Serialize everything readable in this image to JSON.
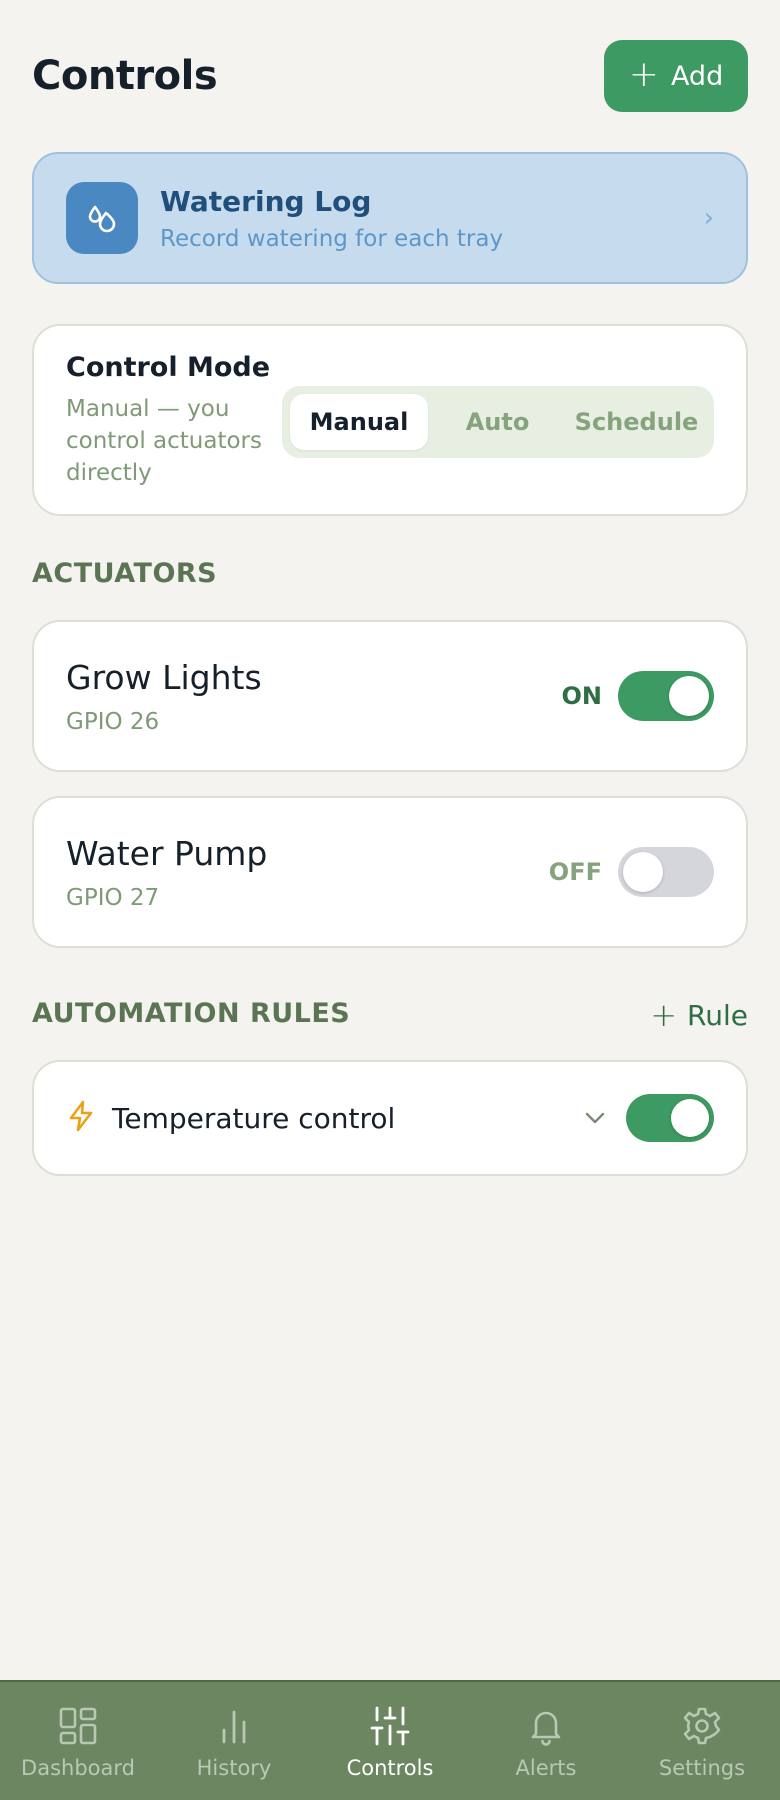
{
  "header": {
    "title": "Controls",
    "add_label": "Add"
  },
  "watering_log": {
    "title": "Watering Log",
    "subtitle": "Record watering for each tray",
    "chevron": "›"
  },
  "control_mode": {
    "title": "Control Mode",
    "description": "Manual — you control actuators directly",
    "options": [
      "Manual",
      "Auto",
      "Schedule"
    ],
    "selected": "Manual"
  },
  "actuators": {
    "section_label": "ACTUATORS",
    "items": [
      {
        "name": "Grow Lights",
        "gpio": "GPIO 26",
        "state": "ON",
        "on": true
      },
      {
        "name": "Water Pump",
        "gpio": "GPIO 27",
        "state": "OFF",
        "on": false
      }
    ]
  },
  "automation": {
    "section_label": "AUTOMATION RULES",
    "add_rule_label": "Rule",
    "rules": [
      {
        "name": "Temperature control",
        "enabled": true,
        "icon": "lightning-icon"
      }
    ]
  },
  "nav": {
    "items": [
      {
        "label": "Dashboard",
        "icon": "dashboard-icon"
      },
      {
        "label": "History",
        "icon": "history-icon"
      },
      {
        "label": "Controls",
        "icon": "controls-icon",
        "active": true
      },
      {
        "label": "Alerts",
        "icon": "bell-icon"
      },
      {
        "label": "Settings",
        "icon": "gear-icon"
      }
    ]
  },
  "colors": {
    "accent": "#3d9a62",
    "nav_background": "#6b8661",
    "watering_background": "#c6dcee",
    "page_background": "#f4f3ef",
    "rule_icon": "#e8a317"
  }
}
